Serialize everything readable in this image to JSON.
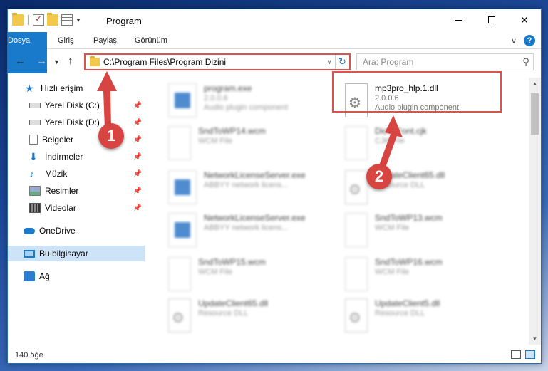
{
  "window": {
    "title": "Program"
  },
  "ribbon": {
    "tabs": [
      "Dosya",
      "Giriş",
      "Paylaş",
      "Görünüm"
    ]
  },
  "address": {
    "path": "C:\\Program Files\\Program Dizini"
  },
  "search": {
    "placeholder": "Ara: Program"
  },
  "sidebar": {
    "items": [
      {
        "label": "Hızlı erişim",
        "icon": "star-icon"
      },
      {
        "label": "Yerel Disk (C:)",
        "icon": "disk-icon",
        "pinned": true
      },
      {
        "label": "Yerel Disk (D:)",
        "icon": "disk-icon",
        "pinned": true
      },
      {
        "label": "Belgeler",
        "icon": "documents-icon",
        "pinned": true
      },
      {
        "label": "İndirmeler",
        "icon": "download-icon",
        "pinned": true
      },
      {
        "label": "Müzik",
        "icon": "music-icon",
        "pinned": true
      },
      {
        "label": "Resimler",
        "icon": "pictures-icon",
        "pinned": true
      },
      {
        "label": "Videolar",
        "icon": "videos-icon",
        "pinned": true
      },
      {
        "label": "OneDrive",
        "icon": "cloud-icon"
      },
      {
        "label": "Bu bilgisayar",
        "icon": "computer-icon",
        "selected": true
      },
      {
        "label": "Ağ",
        "icon": "network-icon"
      }
    ]
  },
  "files": [
    {
      "name": "program.exe",
      "line2": "2.0.0.6",
      "line3": "Audio plugin component",
      "icon": "exe"
    },
    {
      "name": "mp3pro_hlp.1.dll",
      "line2": "2.0.0.6",
      "line3": "Audio plugin component",
      "icon": "gear"
    },
    {
      "name": "SndToWP14.wcm",
      "line2": "WCM File",
      "line3": "",
      "icon": "blank"
    },
    {
      "name": "DictMFont.cjk",
      "line2": "CJK File",
      "line3": "",
      "icon": "blank"
    },
    {
      "name": "NetworkLicenseServer.exe",
      "line2": "ABBYY network licens...",
      "line3": "",
      "icon": "exe"
    },
    {
      "name": "UpdateClient65.dll",
      "line2": "Resource DLL",
      "line3": "",
      "icon": "gear"
    },
    {
      "name": "NetworkLicenseServer.exe",
      "line2": "ABBYY network licens...",
      "line3": "",
      "icon": "exe"
    },
    {
      "name": "SndToWP13.wcm",
      "line2": "WCM File",
      "line3": "",
      "icon": "blank"
    },
    {
      "name": "SndToWP15.wcm",
      "line2": "WCM File",
      "line3": "",
      "icon": "blank"
    },
    {
      "name": "SndToWP16.wcm",
      "line2": "WCM File",
      "line3": "",
      "icon": "blank"
    },
    {
      "name": "UpdateClient65.dll",
      "line2": "Resource DLL",
      "line3": "",
      "icon": "gear"
    },
    {
      "name": "UpdateClient5.dll",
      "line2": "Resource DLL",
      "line3": "",
      "icon": "gear"
    }
  ],
  "markers": [
    "1",
    "2"
  ],
  "status": {
    "count": "140 öğe"
  },
  "colors": {
    "accent": "#1979ca",
    "highlight": "#d9534f",
    "marker": "#d64541"
  }
}
